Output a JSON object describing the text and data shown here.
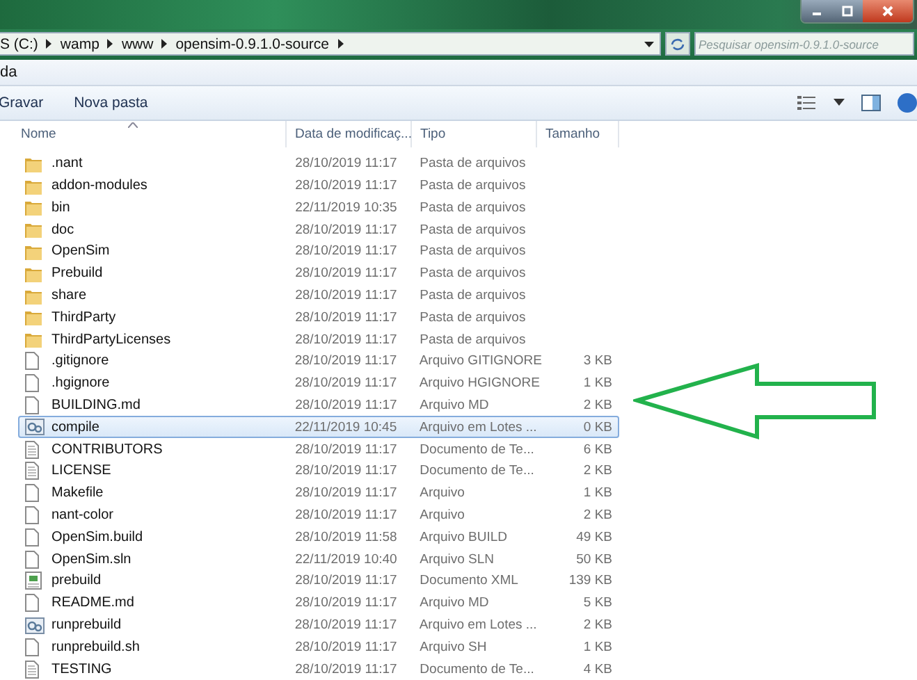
{
  "address_bar": {
    "path": [
      {
        "label": "S (C:)"
      },
      {
        "label": "wamp"
      },
      {
        "label": "www"
      },
      {
        "label": "opensim-0.9.1.0-source"
      }
    ],
    "search": {
      "placeholder": "Pesquisar opensim-0.9.1.0-source"
    }
  },
  "menu_bar": [
    "da"
  ],
  "toolbar": {
    "buttons": [
      "Gravar",
      "Nova pasta"
    ]
  },
  "table": {
    "columns": [
      "Nome",
      "Data de modificaç...",
      "Tipo",
      "Tamanho"
    ],
    "rows": [
      {
        "kind": "folder",
        "name": ".nant",
        "date": "28/10/2019 11:17",
        "type": "Pasta de arquivos",
        "selected": false
      },
      {
        "kind": "folder",
        "name": "addon-modules",
        "date": "28/10/2019 11:17",
        "type": "Pasta de arquivos",
        "selected": false
      },
      {
        "kind": "folder",
        "name": "bin",
        "date": "22/11/2019 10:35",
        "type": "Pasta de arquivos",
        "selected": false
      },
      {
        "kind": "folder",
        "name": "doc",
        "date": "28/10/2019 11:17",
        "type": "Pasta de arquivos",
        "selected": false
      },
      {
        "kind": "folder",
        "name": "OpenSim",
        "date": "28/10/2019 11:17",
        "type": "Pasta de arquivos",
        "selected": false
      },
      {
        "kind": "folder",
        "name": "Prebuild",
        "date": "28/10/2019 11:17",
        "type": "Pasta de arquivos",
        "selected": false
      },
      {
        "kind": "folder",
        "name": "share",
        "date": "28/10/2019 11:17",
        "type": "Pasta de arquivos",
        "selected": false
      },
      {
        "kind": "folder",
        "name": "ThirdParty",
        "date": "28/10/2019 11:17",
        "type": "Pasta de arquivos",
        "selected": false
      },
      {
        "kind": "folder",
        "name": "ThirdPartyLicenses",
        "date": "28/10/2019 11:17",
        "type": "Pasta de arquivos",
        "selected": false
      },
      {
        "kind": "file",
        "name": ".gitignore",
        "date": "28/10/2019 11:17",
        "type": "Arquivo GITIGNORE",
        "size": "3 KB",
        "selected": false
      },
      {
        "kind": "file",
        "name": ".hgignore",
        "date": "28/10/2019 11:17",
        "type": "Arquivo HGIGNORE",
        "size": "1 KB",
        "selected": false
      },
      {
        "kind": "file",
        "name": "BUILDING.md",
        "date": "28/10/2019 11:17",
        "type": "Arquivo MD",
        "size": "2 KB",
        "selected": false
      },
      {
        "kind": "batch",
        "name": "compile",
        "date": "22/11/2019 10:45",
        "type": "Arquivo em Lotes ...",
        "size": "0 KB",
        "selected": true
      },
      {
        "kind": "text",
        "name": "CONTRIBUTORS",
        "date": "28/10/2019 11:17",
        "type": "Documento de Te...",
        "size": "6 KB",
        "selected": false
      },
      {
        "kind": "text",
        "name": "LICENSE",
        "date": "28/10/2019 11:17",
        "type": "Documento de Te...",
        "size": "2 KB",
        "selected": false
      },
      {
        "kind": "file",
        "name": "Makefile",
        "date": "28/10/2019 11:17",
        "type": "Arquivo",
        "size": "1 KB",
        "selected": false
      },
      {
        "kind": "file",
        "name": "nant-color",
        "date": "28/10/2019 11:17",
        "type": "Arquivo",
        "size": "2 KB",
        "selected": false
      },
      {
        "kind": "file",
        "name": "OpenSim.build",
        "date": "28/10/2019 11:58",
        "type": "Arquivo BUILD",
        "size": "49 KB",
        "selected": false
      },
      {
        "kind": "file",
        "name": "OpenSim.sln",
        "date": "22/11/2019 10:40",
        "type": "Arquivo SLN",
        "size": "50 KB",
        "selected": false
      },
      {
        "kind": "xml",
        "name": "prebuild",
        "date": "28/10/2019 11:17",
        "type": "Documento XML",
        "size": "139 KB",
        "selected": false
      },
      {
        "kind": "file",
        "name": "README.md",
        "date": "28/10/2019 11:17",
        "type": "Arquivo MD",
        "size": "5 KB",
        "selected": false
      },
      {
        "kind": "batch",
        "name": "runprebuild",
        "date": "28/10/2019 11:17",
        "type": "Arquivo em Lotes ...",
        "size": "2 KB",
        "selected": false
      },
      {
        "kind": "file",
        "name": "runprebuild.sh",
        "date": "28/10/2019 11:17",
        "type": "Arquivo SH",
        "size": "1 KB",
        "selected": false
      },
      {
        "kind": "text",
        "name": "TESTING",
        "date": "28/10/2019 11:17",
        "type": "Documento de Te...",
        "size": "4 KB",
        "selected": false
      }
    ]
  }
}
